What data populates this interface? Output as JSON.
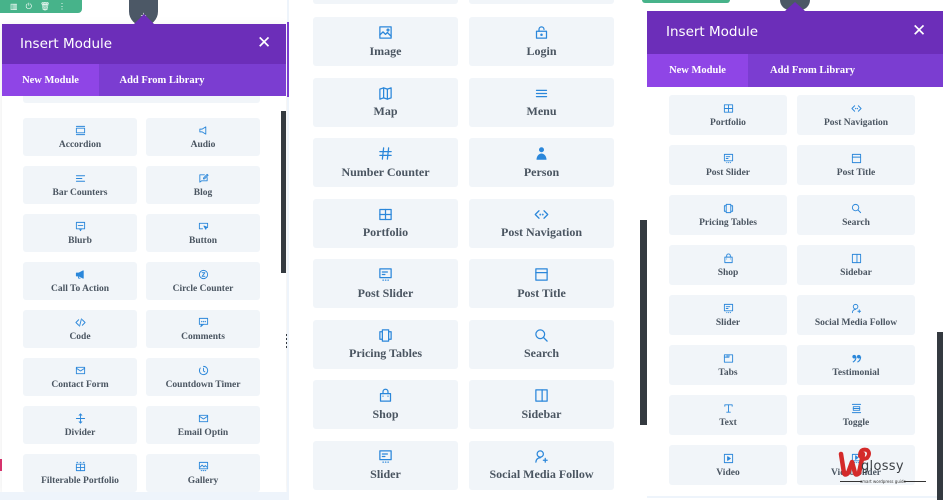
{
  "panel_left": {
    "toolbar_icons": [
      "columns-icon",
      "power-icon",
      "trash-icon",
      "more-icon"
    ],
    "header": {
      "title": "Insert Module",
      "close_glyph": "✕"
    },
    "tabs": [
      {
        "label": "New Module",
        "active": true
      },
      {
        "label": "Add From Library",
        "active": false
      }
    ],
    "modules": [
      {
        "label": "Accordion",
        "icon": "accordion-icon"
      },
      {
        "label": "Audio",
        "icon": "audio-icon"
      },
      {
        "label": "Bar Counters",
        "icon": "bar-counters-icon"
      },
      {
        "label": "Blog",
        "icon": "blog-icon"
      },
      {
        "label": "Blurb",
        "icon": "blurb-icon"
      },
      {
        "label": "Button",
        "icon": "button-icon"
      },
      {
        "label": "Call To Action",
        "icon": "call-to-action-icon"
      },
      {
        "label": "Circle Counter",
        "icon": "circle-counter-icon"
      },
      {
        "label": "Code",
        "icon": "code-icon"
      },
      {
        "label": "Comments",
        "icon": "comments-icon"
      },
      {
        "label": "Contact Form",
        "icon": "contact-form-icon"
      },
      {
        "label": "Countdown Timer",
        "icon": "countdown-timer-icon"
      },
      {
        "label": "Divider",
        "icon": "divider-icon"
      },
      {
        "label": "Email Optin",
        "icon": "email-optin-icon"
      },
      {
        "label": "Filterable Portfolio",
        "icon": "filterable-portfolio-icon"
      },
      {
        "label": "Gallery",
        "icon": "gallery-icon"
      }
    ]
  },
  "panel_middle": {
    "modules": [
      {
        "label": "",
        "icon": ""
      },
      {
        "label": "",
        "icon": ""
      },
      {
        "label": "Image",
        "icon": "image-icon"
      },
      {
        "label": "Login",
        "icon": "login-icon"
      },
      {
        "label": "Map",
        "icon": "map-icon"
      },
      {
        "label": "Menu",
        "icon": "menu-icon"
      },
      {
        "label": "Number Counter",
        "icon": "number-counter-icon"
      },
      {
        "label": "Person",
        "icon": "person-icon"
      },
      {
        "label": "Portfolio",
        "icon": "portfolio-icon"
      },
      {
        "label": "Post Navigation",
        "icon": "post-navigation-icon"
      },
      {
        "label": "Post Slider",
        "icon": "post-slider-icon"
      },
      {
        "label": "Post Title",
        "icon": "post-title-icon"
      },
      {
        "label": "Pricing Tables",
        "icon": "pricing-tables-icon"
      },
      {
        "label": "Search",
        "icon": "search-icon"
      },
      {
        "label": "Shop",
        "icon": "shop-icon"
      },
      {
        "label": "Sidebar",
        "icon": "sidebar-icon"
      },
      {
        "label": "Slider",
        "icon": "slider-icon"
      },
      {
        "label": "Social Media Follow",
        "icon": "social-media-follow-icon"
      }
    ]
  },
  "panel_right": {
    "header": {
      "title": "Insert Module",
      "close_glyph": "✕"
    },
    "tabs": [
      {
        "label": "New Module",
        "active": true
      },
      {
        "label": "Add From Library",
        "active": false
      }
    ],
    "modules": [
      {
        "label": "Portfolio",
        "icon": "portfolio-icon"
      },
      {
        "label": "Post Navigation",
        "icon": "post-navigation-icon"
      },
      {
        "label": "Post Slider",
        "icon": "post-slider-icon"
      },
      {
        "label": "Post Title",
        "icon": "post-title-icon"
      },
      {
        "label": "Pricing Tables",
        "icon": "pricing-tables-icon"
      },
      {
        "label": "Search",
        "icon": "search-icon"
      },
      {
        "label": "Shop",
        "icon": "shop-icon"
      },
      {
        "label": "Sidebar",
        "icon": "sidebar-icon"
      },
      {
        "label": "Slider",
        "icon": "slider-icon"
      },
      {
        "label": "Social Media Follow",
        "icon": "social-media-follow-icon"
      },
      {
        "label": "Tabs",
        "icon": "tabs-icon"
      },
      {
        "label": "Testimonial",
        "icon": "testimonial-icon"
      },
      {
        "label": "Text",
        "icon": "text-icon"
      },
      {
        "label": "Toggle",
        "icon": "toggle-icon"
      },
      {
        "label": "Video",
        "icon": "video-icon"
      },
      {
        "label": "Video Slider",
        "icon": "video-slider-icon"
      }
    ]
  },
  "watermark": {
    "brand": "glossy",
    "tagline": "smart wordpress guide"
  },
  "colors": {
    "header_purple": "#6c2eb9",
    "tabs_purple": "#7b3dd1",
    "active_tab_purple": "#8f45e6",
    "icon_blue": "#2b87da",
    "module_bg": "#f1f5f9",
    "module_text": "#4a5561",
    "toolbar_green": "#47b38a",
    "watermark_red": "#d42a2a"
  }
}
